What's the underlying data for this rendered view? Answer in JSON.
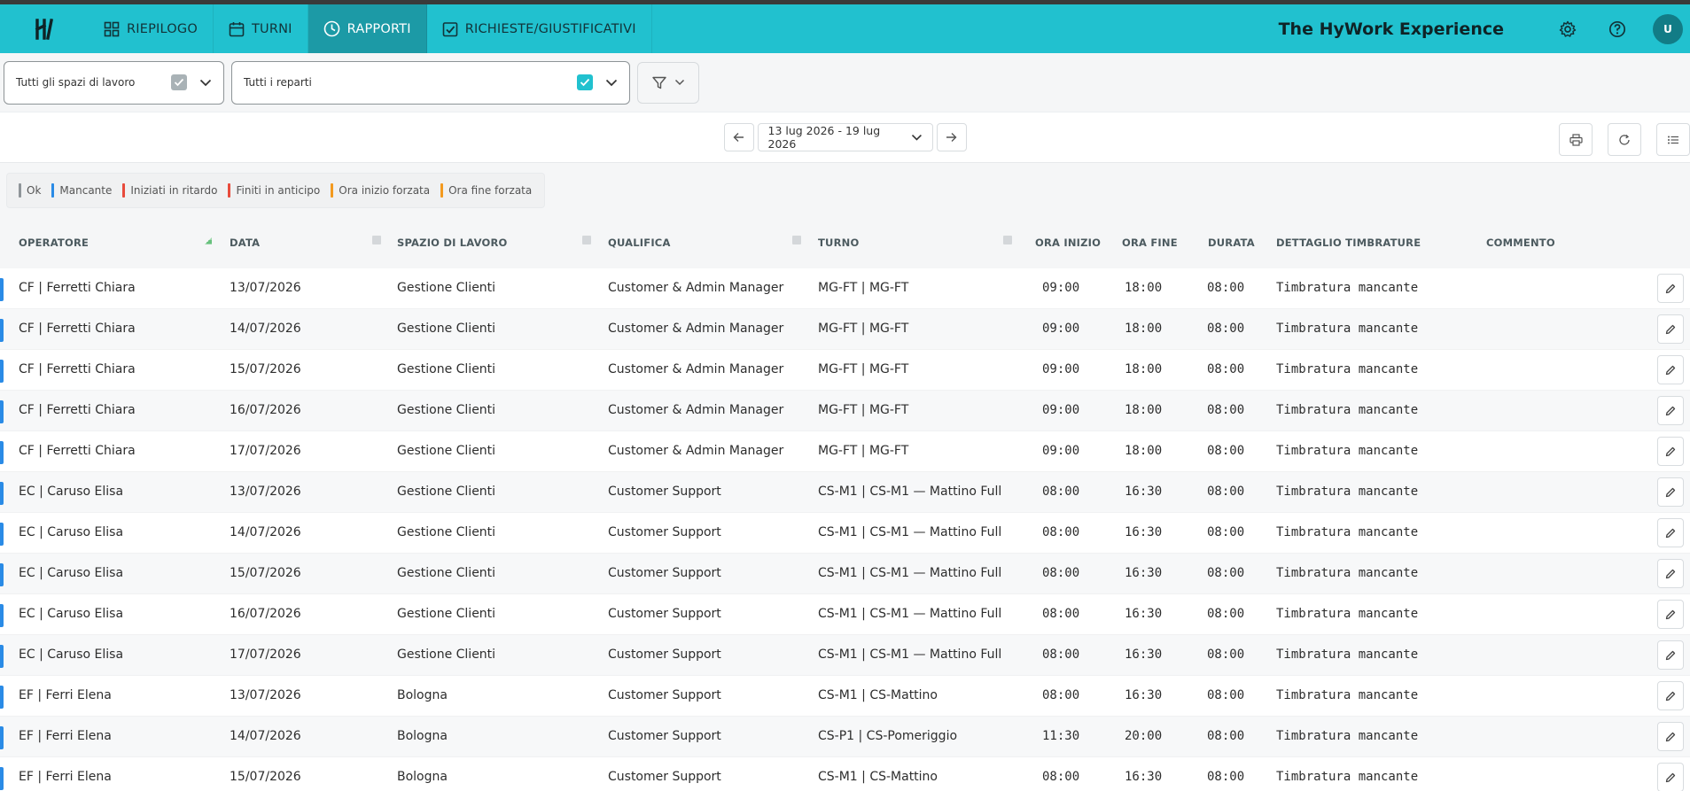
{
  "nav": {
    "logo_text": "H",
    "items": [
      {
        "label": "RIEPILOGO",
        "icon": "dashboard-icon",
        "active": false
      },
      {
        "label": "TURNI",
        "icon": "calendar-icon",
        "active": false
      },
      {
        "label": "RAPPORTI",
        "icon": "clock-icon",
        "active": true
      },
      {
        "label": "RICHIESTE/GIUSTIFICATIVI",
        "icon": "check-square-icon",
        "active": false
      }
    ],
    "brand": "The HyWork Experience",
    "avatar": "U"
  },
  "filters": {
    "workspaces": "Tutti gli spazi di lavoro",
    "departments": "Tutti i reparti"
  },
  "date_range": "13 lug 2026 - 19 lug 2026",
  "legend": [
    {
      "label": "Ok",
      "color": "#8f9599"
    },
    {
      "label": "Mancante",
      "color": "#2a8be6"
    },
    {
      "label": "Iniziati in ritardo",
      "color": "#e84b3c"
    },
    {
      "label": "Finiti in anticipo",
      "color": "#e84b3c"
    },
    {
      "label": "Ora inizio forzata",
      "color": "#f39a1f"
    },
    {
      "label": "Ora fine forzata",
      "color": "#f39a1f"
    }
  ],
  "columns": {
    "operatore": "OPERATORE",
    "data": "DATA",
    "spazio": "SPAZIO DI LAVORO",
    "qualifica": "QUALIFICA",
    "turno": "TURNO",
    "ora_inizio": "ORA INIZIO",
    "ora_fine": "ORA FINE",
    "durata": "DURATA",
    "dettaglio": "DETTAGLIO TIMBRATURE",
    "commento": "COMMENTO"
  },
  "rows": [
    {
      "operatore": "CF | Ferretti Chiara",
      "data": "13/07/2026",
      "spazio": "Gestione Clienti",
      "qualifica": "Customer & Admin Manager",
      "turno": "MG-FT | MG-FT",
      "inizio": "09:00",
      "fine": "18:00",
      "durata": "08:00",
      "dettaglio": "Timbratura mancante"
    },
    {
      "operatore": "CF | Ferretti Chiara",
      "data": "14/07/2026",
      "spazio": "Gestione Clienti",
      "qualifica": "Customer & Admin Manager",
      "turno": "MG-FT | MG-FT",
      "inizio": "09:00",
      "fine": "18:00",
      "durata": "08:00",
      "dettaglio": "Timbratura mancante"
    },
    {
      "operatore": "CF | Ferretti Chiara",
      "data": "15/07/2026",
      "spazio": "Gestione Clienti",
      "qualifica": "Customer & Admin Manager",
      "turno": "MG-FT | MG-FT",
      "inizio": "09:00",
      "fine": "18:00",
      "durata": "08:00",
      "dettaglio": "Timbratura mancante"
    },
    {
      "operatore": "CF | Ferretti Chiara",
      "data": "16/07/2026",
      "spazio": "Gestione Clienti",
      "qualifica": "Customer & Admin Manager",
      "turno": "MG-FT | MG-FT",
      "inizio": "09:00",
      "fine": "18:00",
      "durata": "08:00",
      "dettaglio": "Timbratura mancante"
    },
    {
      "operatore": "CF | Ferretti Chiara",
      "data": "17/07/2026",
      "spazio": "Gestione Clienti",
      "qualifica": "Customer & Admin Manager",
      "turno": "MG-FT | MG-FT",
      "inizio": "09:00",
      "fine": "18:00",
      "durata": "08:00",
      "dettaglio": "Timbratura mancante"
    },
    {
      "operatore": "EC | Caruso Elisa",
      "data": "13/07/2026",
      "spazio": "Gestione Clienti",
      "qualifica": "Customer Support",
      "turno": "CS-M1 | CS-M1 — Mattino Full",
      "inizio": "08:00",
      "fine": "16:30",
      "durata": "08:00",
      "dettaglio": "Timbratura mancante"
    },
    {
      "operatore": "EC | Caruso Elisa",
      "data": "14/07/2026",
      "spazio": "Gestione Clienti",
      "qualifica": "Customer Support",
      "turno": "CS-M1 | CS-M1 — Mattino Full",
      "inizio": "08:00",
      "fine": "16:30",
      "durata": "08:00",
      "dettaglio": "Timbratura mancante"
    },
    {
      "operatore": "EC | Caruso Elisa",
      "data": "15/07/2026",
      "spazio": "Gestione Clienti",
      "qualifica": "Customer Support",
      "turno": "CS-M1 | CS-M1 — Mattino Full",
      "inizio": "08:00",
      "fine": "16:30",
      "durata": "08:00",
      "dettaglio": "Timbratura mancante"
    },
    {
      "operatore": "EC | Caruso Elisa",
      "data": "16/07/2026",
      "spazio": "Gestione Clienti",
      "qualifica": "Customer Support",
      "turno": "CS-M1 | CS-M1 — Mattino Full",
      "inizio": "08:00",
      "fine": "16:30",
      "durata": "08:00",
      "dettaglio": "Timbratura mancante"
    },
    {
      "operatore": "EC | Caruso Elisa",
      "data": "17/07/2026",
      "spazio": "Gestione Clienti",
      "qualifica": "Customer Support",
      "turno": "CS-M1 | CS-M1 — Mattino Full",
      "inizio": "08:00",
      "fine": "16:30",
      "durata": "08:00",
      "dettaglio": "Timbratura mancante"
    },
    {
      "operatore": "EF | Ferri Elena",
      "data": "13/07/2026",
      "spazio": "Bologna",
      "qualifica": "Customer Support",
      "turno": "CS-M1 | CS-Mattino",
      "inizio": "08:00",
      "fine": "16:30",
      "durata": "08:00",
      "dettaglio": "Timbratura mancante"
    },
    {
      "operatore": "EF | Ferri Elena",
      "data": "14/07/2026",
      "spazio": "Bologna",
      "qualifica": "Customer Support",
      "turno": "CS-P1 | CS-Pomeriggio",
      "inizio": "11:30",
      "fine": "20:00",
      "durata": "08:00",
      "dettaglio": "Timbratura mancante"
    },
    {
      "operatore": "EF | Ferri Elena",
      "data": "15/07/2026",
      "spazio": "Bologna",
      "qualifica": "Customer Support",
      "turno": "CS-M1 | CS-Mattino",
      "inizio": "08:00",
      "fine": "16:30",
      "durata": "08:00",
      "dettaglio": "Timbratura mancante"
    }
  ]
}
